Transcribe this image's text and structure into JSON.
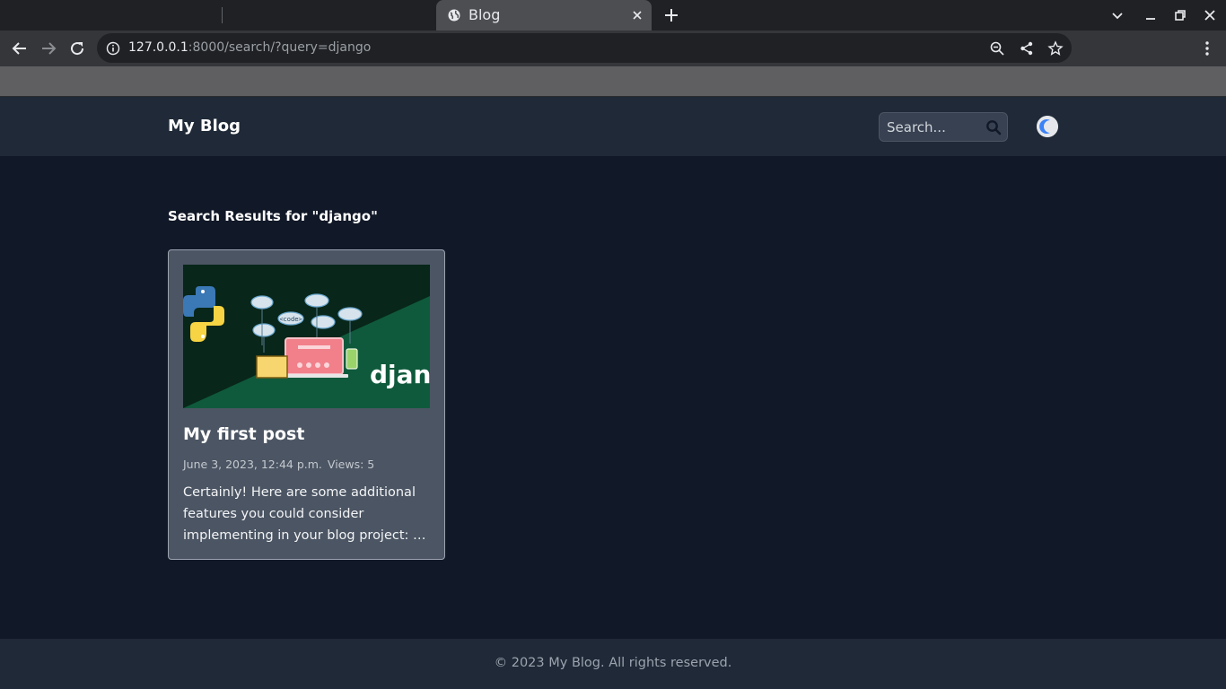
{
  "browser": {
    "tab_title": "Blog",
    "url_host": "127.0.0.1",
    "url_rest": ":8000/search/?query=django"
  },
  "site": {
    "brand": "My Blog",
    "search_placeholder": "Search...",
    "results_heading": "Search Results for \"django\"",
    "footer": "© 2023 My Blog. All rights reserved."
  },
  "results": [
    {
      "title": "My first post",
      "date": "June 3, 2023, 12:44 p.m.",
      "views": "Views: 5",
      "excerpt": "Certainly! Here are some additional features you could consider implementing in your blog project: …",
      "image_text": "djang",
      "image_code_label": "<code>"
    }
  ],
  "colors": {
    "page_bg": "#111827",
    "header_bg": "#1f2937",
    "card_bg": "#4b5563",
    "accent_moon": "#3b82f6"
  }
}
